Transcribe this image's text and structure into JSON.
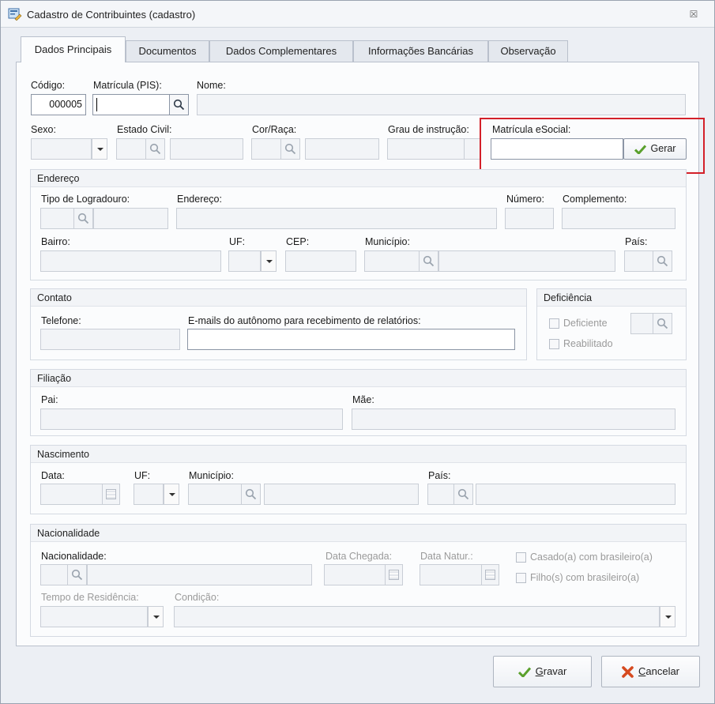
{
  "window": {
    "title": "Cadastro de Contribuintes (cadastro)",
    "close_glyph": "☒"
  },
  "tabs": [
    {
      "label": "Dados Principais",
      "active": true
    },
    {
      "label": "Documentos"
    },
    {
      "label": "Dados Complementares"
    },
    {
      "label": "Informações Bancárias"
    },
    {
      "label": "Observação"
    }
  ],
  "main": {
    "codigo_label": "Código:",
    "codigo_value": "000005",
    "matricula_label": "Matrícula (PIS):",
    "matricula_value": "",
    "nome_label": "Nome:",
    "sexo_label": "Sexo:",
    "estado_civil_label": "Estado Civil:",
    "cor_raca_label": "Cor/Raça:",
    "grau_label": "Grau de instrução:",
    "esocial_label": "Matrícula eSocial:",
    "gerar_label": "Gerar"
  },
  "endereco": {
    "title": "Endereço",
    "tipo_label": "Tipo de Logradouro:",
    "endereco_label": "Endereço:",
    "numero_label": "Número:",
    "complemento_label": "Complemento:",
    "bairro_label": "Bairro:",
    "uf_label": "UF:",
    "cep_label": "CEP:",
    "municipio_label": "Município:",
    "pais_label": "País:"
  },
  "contato": {
    "title": "Contato",
    "telefone_label": "Telefone:",
    "emails_label": "E-mails do autônomo para recebimento de relatórios:"
  },
  "deficiencia": {
    "title": "Deficiência",
    "deficiente_label": "Deficiente",
    "reabilitado_label": "Reabilitado"
  },
  "filiacao": {
    "title": "Filiação",
    "pai_label": "Pai:",
    "mae_label": "Mãe:"
  },
  "nascimento": {
    "title": "Nascimento",
    "data_label": "Data:",
    "uf_label": "UF:",
    "municipio_label": "Município:",
    "pais_label": "País:"
  },
  "nacionalidade": {
    "title": "Nacionalidade",
    "nacionalidade_label": "Nacionalidade:",
    "data_chegada_label": "Data Chegada:",
    "data_natur_label": "Data Natur.:",
    "casado_label": "Casado(a) com brasileiro(a)",
    "filhos_label": "Filho(s) com brasileiro(a)",
    "tempo_label": "Tempo de Residência:",
    "condicao_label": "Condição:"
  },
  "footer": {
    "gravar_label": "Gravar",
    "gravar_accel": "G",
    "gravar_rest": "ravar",
    "cancelar_label": "Cancelar",
    "cancelar_accel": "C",
    "cancelar_rest": "ancelar"
  },
  "colors": {
    "highlight": "#d32029",
    "check_green": "#5aa02c",
    "cancel_red": "#d64a1f"
  }
}
